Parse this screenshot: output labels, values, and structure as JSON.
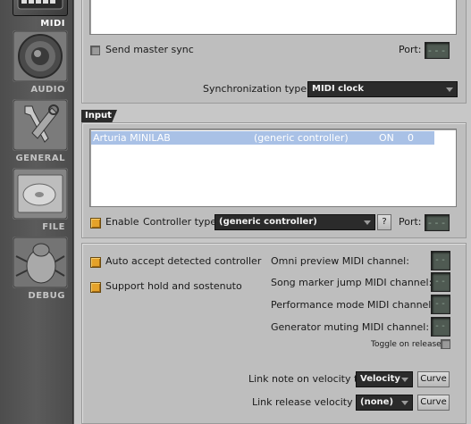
{
  "sidebar": {
    "items": [
      {
        "label": "MIDI",
        "icon": "midi-icon",
        "active": true
      },
      {
        "label": "AUDIO",
        "icon": "speaker-icon",
        "active": false
      },
      {
        "label": "GENERAL",
        "icon": "wrench-icon",
        "active": false
      },
      {
        "label": "FILE",
        "icon": "disc-icon",
        "active": false
      },
      {
        "label": "DEBUG",
        "icon": "bug-icon",
        "active": false
      }
    ]
  },
  "output": {
    "send_master_sync_label": "Send master sync",
    "port_label": "Port:",
    "port_value": "---",
    "sync_type_label": "Synchronization type:",
    "sync_type_value": "MIDI clock"
  },
  "input": {
    "section_label": "Input",
    "devices": [
      {
        "name": "Arturia MINILAB",
        "controller": "(generic controller)",
        "state": "ON",
        "port": "0"
      }
    ],
    "enable_label": "Enable",
    "controller_type_label": "Controller type:",
    "controller_type_value": "(generic controller)",
    "help_label": "?",
    "port_label": "Port:",
    "port_value": "---"
  },
  "options": {
    "auto_accept_label": "Auto accept detected controller",
    "support_hold_label": "Support hold and sostenuto",
    "omni_preview_label": "Omni preview MIDI channel:",
    "song_marker_label": "Song marker jump MIDI channel:",
    "performance_mode_label": "Performance mode MIDI channel:",
    "generator_muting_label": "Generator muting MIDI channel:",
    "channel_value": "--",
    "toggle_on_release_label": "Toggle on release",
    "link_note_on_label": "Link note on velocity to:",
    "link_note_on_value": "Velocity",
    "link_release_label": "Link release velocity to:",
    "link_release_value": "(none)",
    "curve_label": "Curve"
  },
  "colors": {
    "accent_checkbox": "#e5a22a",
    "selection": "#a9c1e6",
    "panel": "#c7c7c7",
    "combo_bg": "#2b2b2b"
  }
}
